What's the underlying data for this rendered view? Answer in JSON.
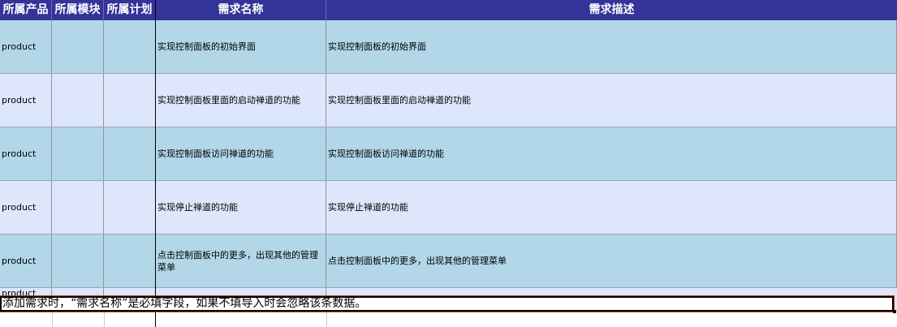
{
  "columns": {
    "product": "所属产品",
    "module": "所属模块",
    "plan": "所属计划",
    "name": "需求名称",
    "desc": "需求描述"
  },
  "rows": [
    {
      "product": "product",
      "module": "",
      "plan": "",
      "name": "实现控制面板的初始界面",
      "desc": "实现控制面板的初始界面"
    },
    {
      "product": "product",
      "module": "",
      "plan": "",
      "name": "实现控制面板里面的启动禅道的功能",
      "desc": "实现控制面板里面的启动禅道的功能"
    },
    {
      "product": "product",
      "module": "",
      "plan": "",
      "name": "实现控制面板访问禅道的功能",
      "desc": "实现控制面板访问禅道的功能"
    },
    {
      "product": "product",
      "module": "",
      "plan": "",
      "name": "实现停止禅道的功能",
      "desc": "实现停止禅道的功能"
    },
    {
      "product": "product",
      "module": "",
      "plan": "",
      "name": "点击控制面板中的更多，出现其他的管理菜单",
      "desc": "点击控制面板中的更多，出现其他的管理菜单"
    }
  ],
  "partial_row": {
    "product": "product"
  },
  "comment": "添加需求时，“需求名称”是必填字段，如果不填导入时会忽略该条数据。",
  "colors": {
    "header": "#333399",
    "row_odd": "#b1d7e8",
    "row_even": "#dde6fb"
  }
}
